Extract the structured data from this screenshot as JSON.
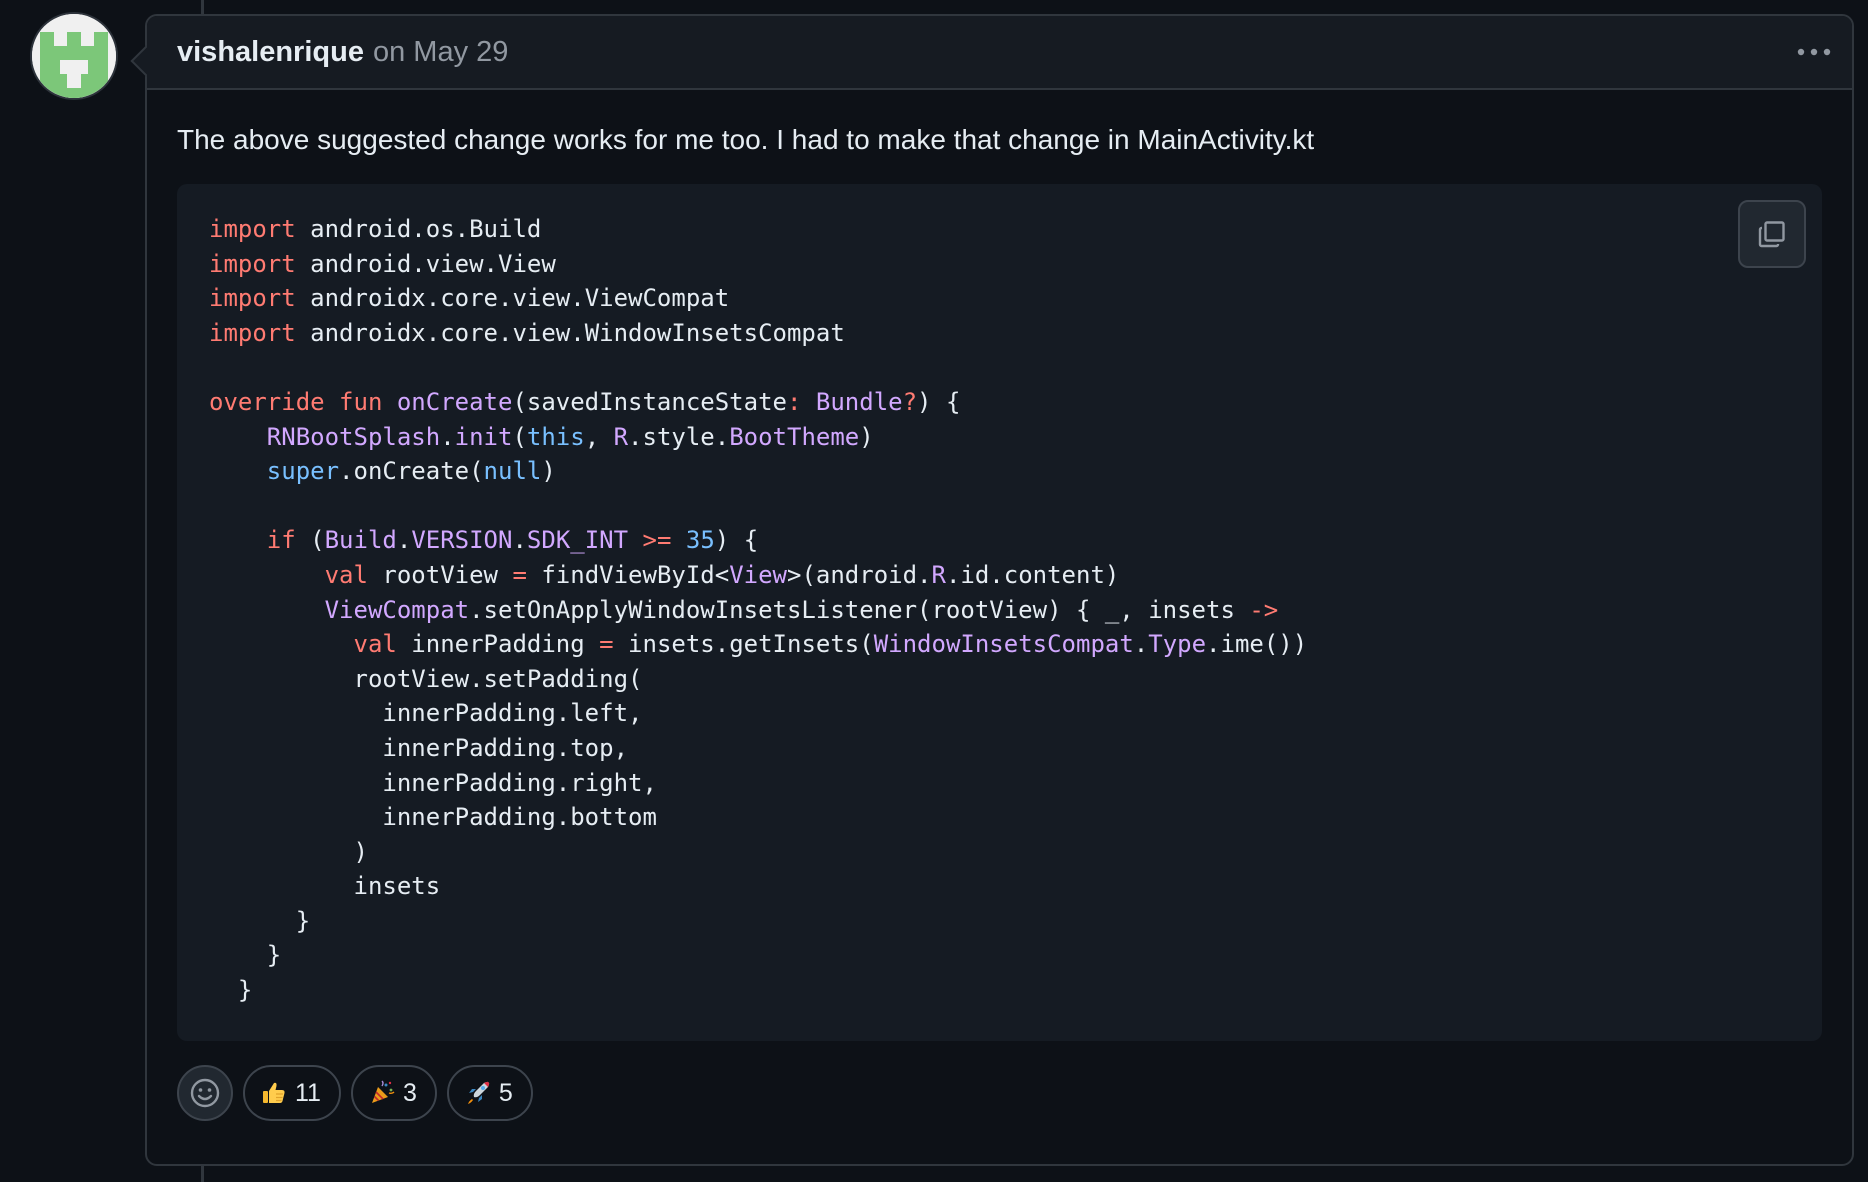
{
  "comment": {
    "author": "vishalenrique",
    "date": "on May 29",
    "body_text": "The above suggested change works for me too. I had to make that change in MainActivity.kt",
    "more_icon": "kebab-horizontal-icon"
  },
  "code": {
    "language": "kotlin",
    "copy_icon": "copy-icon",
    "lines": [
      [
        {
          "t": "import",
          "c": "kw"
        },
        {
          "t": " android.os.Build",
          "c": ""
        }
      ],
      [
        {
          "t": "import",
          "c": "kw"
        },
        {
          "t": " android.view.View",
          "c": ""
        }
      ],
      [
        {
          "t": "import",
          "c": "kw"
        },
        {
          "t": " androidx.core.view.ViewCompat",
          "c": ""
        }
      ],
      [
        {
          "t": "import",
          "c": "kw"
        },
        {
          "t": " androidx.core.view.WindowInsetsCompat",
          "c": ""
        }
      ],
      [],
      [
        {
          "t": "override fun ",
          "c": "kw"
        },
        {
          "t": "onCreate",
          "c": "fn"
        },
        {
          "t": "(savedInstanceState",
          "c": ""
        },
        {
          "t": ": ",
          "c": "kw"
        },
        {
          "t": "Bundle",
          "c": "fn"
        },
        {
          "t": "?",
          "c": "kw"
        },
        {
          "t": ") {",
          "c": ""
        }
      ],
      [
        {
          "t": "    ",
          "c": ""
        },
        {
          "t": "RNBootSplash",
          "c": "fn"
        },
        {
          "t": ".",
          "c": ""
        },
        {
          "t": "init",
          "c": "fn"
        },
        {
          "t": "(",
          "c": ""
        },
        {
          "t": "this",
          "c": "cn"
        },
        {
          "t": ", ",
          "c": ""
        },
        {
          "t": "R",
          "c": "fn"
        },
        {
          "t": ".style.",
          "c": ""
        },
        {
          "t": "BootTheme",
          "c": "fn"
        },
        {
          "t": ")",
          "c": ""
        }
      ],
      [
        {
          "t": "    ",
          "c": ""
        },
        {
          "t": "super",
          "c": "cn"
        },
        {
          "t": ".onCreate(",
          "c": ""
        },
        {
          "t": "null",
          "c": "cn"
        },
        {
          "t": ")",
          "c": ""
        }
      ],
      [],
      [
        {
          "t": "    ",
          "c": ""
        },
        {
          "t": "if",
          "c": "kw"
        },
        {
          "t": " (",
          "c": ""
        },
        {
          "t": "Build",
          "c": "fn"
        },
        {
          "t": ".",
          "c": ""
        },
        {
          "t": "VERSION",
          "c": "fn"
        },
        {
          "t": ".",
          "c": ""
        },
        {
          "t": "SDK_INT",
          "c": "fn"
        },
        {
          "t": " ",
          "c": ""
        },
        {
          "t": ">=",
          "c": "kw"
        },
        {
          "t": " ",
          "c": ""
        },
        {
          "t": "35",
          "c": "cn"
        },
        {
          "t": ") {",
          "c": ""
        }
      ],
      [
        {
          "t": "        ",
          "c": ""
        },
        {
          "t": "val",
          "c": "kw"
        },
        {
          "t": " rootView ",
          "c": ""
        },
        {
          "t": "=",
          "c": "kw"
        },
        {
          "t": " findViewById<",
          "c": ""
        },
        {
          "t": "View",
          "c": "fn"
        },
        {
          "t": ">(android.",
          "c": ""
        },
        {
          "t": "R",
          "c": "fn"
        },
        {
          "t": ".id.content)",
          "c": ""
        }
      ],
      [
        {
          "t": "        ",
          "c": ""
        },
        {
          "t": "ViewCompat",
          "c": "fn"
        },
        {
          "t": ".setOnApplyWindowInsetsListener(rootView) { _, insets ",
          "c": ""
        },
        {
          "t": "->",
          "c": "kw"
        }
      ],
      [
        {
          "t": "          ",
          "c": ""
        },
        {
          "t": "val",
          "c": "kw"
        },
        {
          "t": " innerPadding ",
          "c": ""
        },
        {
          "t": "=",
          "c": "kw"
        },
        {
          "t": " insets.getInsets(",
          "c": ""
        },
        {
          "t": "WindowInsetsCompat",
          "c": "fn"
        },
        {
          "t": ".",
          "c": ""
        },
        {
          "t": "Type",
          "c": "fn"
        },
        {
          "t": ".ime())",
          "c": ""
        }
      ],
      [
        {
          "t": "          rootView.setPadding(",
          "c": ""
        }
      ],
      [
        {
          "t": "            innerPadding.left,",
          "c": ""
        }
      ],
      [
        {
          "t": "            innerPadding.top,",
          "c": ""
        }
      ],
      [
        {
          "t": "            innerPadding.right,",
          "c": ""
        }
      ],
      [
        {
          "t": "            innerPadding.bottom",
          "c": ""
        }
      ],
      [
        {
          "t": "          )",
          "c": ""
        }
      ],
      [
        {
          "t": "          insets",
          "c": ""
        }
      ],
      [
        {
          "t": "      }",
          "c": ""
        }
      ],
      [
        {
          "t": "    }",
          "c": ""
        }
      ],
      [
        {
          "t": "  }",
          "c": ""
        }
      ]
    ]
  },
  "reactions": {
    "picker_icon": "smiley-icon",
    "items": [
      {
        "emoji": "👍",
        "icon": "thumbs-up-icon",
        "count": "11"
      },
      {
        "emoji": "🎉",
        "icon": "party-popper-icon",
        "count": "3"
      },
      {
        "emoji": "🚀",
        "icon": "rocket-icon",
        "count": "5"
      }
    ]
  },
  "colors": {
    "background": "#0d1117",
    "header": "#161b22",
    "border": "#30363d",
    "code_bg": "#151b23",
    "keyword": "#ff7b72",
    "entity": "#d2a8ff",
    "constant": "#79c0ff"
  }
}
